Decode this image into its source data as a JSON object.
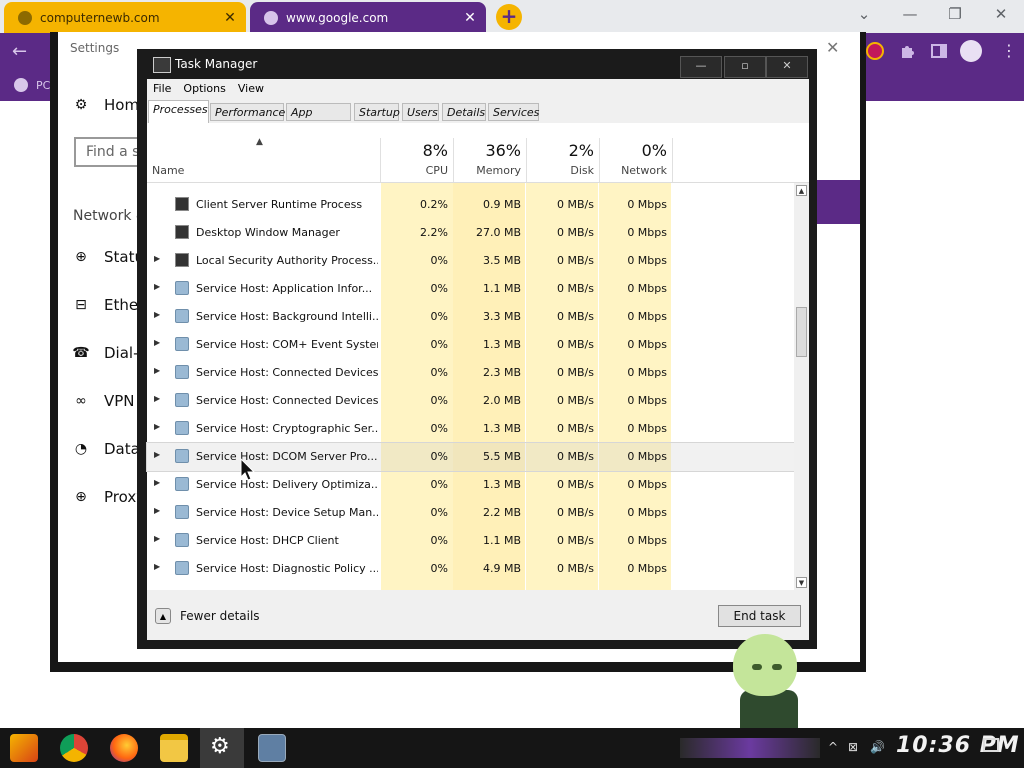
{
  "browser": {
    "tabs": [
      {
        "title": "computernewb.com",
        "close": "✕"
      },
      {
        "title": "www.google.com",
        "close": "✕"
      }
    ],
    "new_tab": "+",
    "window_controls": {
      "list": "⌄",
      "minimize": "—",
      "restore": "❐",
      "close": "✕"
    },
    "back": "←",
    "bookmark_text": "PC"
  },
  "settings": {
    "title": "Settings",
    "close": "✕",
    "search_placeholder": "Find a se",
    "section": "Network &",
    "nav": [
      {
        "label": "Hom",
        "icon": "home-icon",
        "glyph": "⚙"
      },
      {
        "label": "Statu",
        "icon": "globe-icon",
        "glyph": "⊕"
      },
      {
        "label": "Ether",
        "icon": "ethernet-icon",
        "glyph": "⊟"
      },
      {
        "label": "Dial-",
        "icon": "dialup-icon",
        "glyph": "☎"
      },
      {
        "label": "VPN",
        "icon": "vpn-icon",
        "glyph": "∞"
      },
      {
        "label": "Data",
        "icon": "data-usage-icon",
        "glyph": "◔"
      },
      {
        "label": "Proxy",
        "icon": "proxy-globe-icon",
        "glyph": "⊕"
      }
    ]
  },
  "taskmanager": {
    "title": "Task Manager",
    "buttons": {
      "minimize": "—",
      "maximize": "▫",
      "close": "✕"
    },
    "menu": [
      "File",
      "Options",
      "View"
    ],
    "tabs": [
      "Processes",
      "Performance",
      "App history",
      "Startup",
      "Users",
      "Details",
      "Services"
    ],
    "active_tab": "Processes",
    "columns": {
      "name": "Name",
      "cpu": {
        "pct": "8%",
        "label": "CPU"
      },
      "memory": {
        "pct": "36%",
        "label": "Memory"
      },
      "disk": {
        "pct": "2%",
        "label": "Disk"
      },
      "network": {
        "pct": "0%",
        "label": "Network"
      }
    },
    "sort_indicator": "▲",
    "rows": [
      {
        "name": "Client Server Runtime Process",
        "cpu": "0.2%",
        "memory": "0.9 MB",
        "disk": "0 MB/s",
        "network": "0 Mbps",
        "expandable": false,
        "icon": "app"
      },
      {
        "name": "Desktop Window Manager",
        "cpu": "2.2%",
        "memory": "27.0 MB",
        "disk": "0 MB/s",
        "network": "0 Mbps",
        "expandable": false,
        "icon": "app"
      },
      {
        "name": "Local Security Authority Process...",
        "cpu": "0%",
        "memory": "3.5 MB",
        "disk": "0 MB/s",
        "network": "0 Mbps",
        "expandable": true,
        "icon": "app"
      },
      {
        "name": "Service Host: Application Infor...",
        "cpu": "0%",
        "memory": "1.1 MB",
        "disk": "0 MB/s",
        "network": "0 Mbps",
        "expandable": true,
        "icon": "svc"
      },
      {
        "name": "Service Host: Background Intelli...",
        "cpu": "0%",
        "memory": "3.3 MB",
        "disk": "0 MB/s",
        "network": "0 Mbps",
        "expandable": true,
        "icon": "svc"
      },
      {
        "name": "Service Host: COM+ Event System",
        "cpu": "0%",
        "memory": "1.3 MB",
        "disk": "0 MB/s",
        "network": "0 Mbps",
        "expandable": true,
        "icon": "svc"
      },
      {
        "name": "Service Host: Connected Devices...",
        "cpu": "0%",
        "memory": "2.3 MB",
        "disk": "0 MB/s",
        "network": "0 Mbps",
        "expandable": true,
        "icon": "svc"
      },
      {
        "name": "Service Host: Connected Devices...",
        "cpu": "0%",
        "memory": "2.0 MB",
        "disk": "0 MB/s",
        "network": "0 Mbps",
        "expandable": true,
        "icon": "svc"
      },
      {
        "name": "Service Host: Cryptographic Ser...",
        "cpu": "0%",
        "memory": "1.3 MB",
        "disk": "0 MB/s",
        "network": "0 Mbps",
        "expandable": true,
        "icon": "svc"
      },
      {
        "name": "Service Host: DCOM Server Pro...",
        "cpu": "0%",
        "memory": "5.5 MB",
        "disk": "0 MB/s",
        "network": "0 Mbps",
        "expandable": true,
        "icon": "svc"
      },
      {
        "name": "Service Host: Delivery Optimiza...",
        "cpu": "0%",
        "memory": "1.3 MB",
        "disk": "0 MB/s",
        "network": "0 Mbps",
        "expandable": true,
        "icon": "svc"
      },
      {
        "name": "Service Host: Device Setup Man...",
        "cpu": "0%",
        "memory": "2.2 MB",
        "disk": "0 MB/s",
        "network": "0 Mbps",
        "expandable": true,
        "icon": "svc"
      },
      {
        "name": "Service Host: DHCP Client",
        "cpu": "0%",
        "memory": "1.1 MB",
        "disk": "0 MB/s",
        "network": "0 Mbps",
        "expandable": true,
        "icon": "svc"
      },
      {
        "name": "Service Host: Diagnostic Policy ...",
        "cpu": "0%",
        "memory": "4.9 MB",
        "disk": "0 MB/s",
        "network": "0 Mbps",
        "expandable": true,
        "icon": "svc"
      }
    ],
    "expand_glyph": "▶",
    "fewer_details": "Fewer details",
    "fewer_glyph": "▲",
    "end_task": "End task",
    "scroll_up": "▲",
    "scroll_down": "▼"
  },
  "taskbar": {
    "clock": "10:36 PM",
    "apps": [
      "start-icon",
      "chrome-icon",
      "firefox-icon",
      "file-explorer-icon",
      "settings-icon",
      "task-manager-icon"
    ],
    "tray": [
      "chevron-up-icon",
      "network-icon",
      "volume-icon",
      "notification-icon"
    ],
    "tray_glyphs": {
      "chevron": "^",
      "network": "⊠",
      "volume": "🔊"
    }
  }
}
